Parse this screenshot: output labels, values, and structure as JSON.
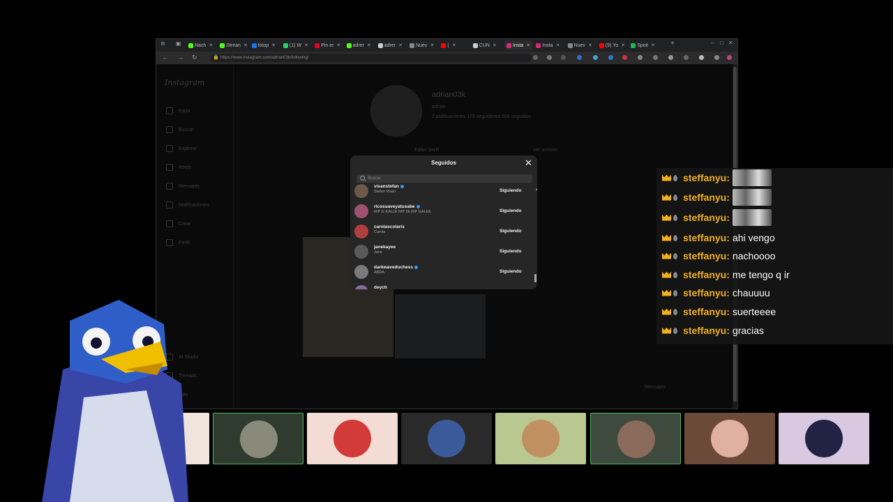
{
  "browser": {
    "tabs": [
      {
        "label": "Nach",
        "color": "#53fc18"
      },
      {
        "label": "Strean",
        "color": "#53fc18"
      },
      {
        "label": "fotop",
        "color": "#1a73e8"
      },
      {
        "label": "(1) W",
        "color": "#25d366"
      },
      {
        "label": "Pin er",
        "color": "#e60023"
      },
      {
        "label": "adrer",
        "color": "#53fc18"
      },
      {
        "label": "adrer",
        "color": "#cccccc"
      },
      {
        "label": "Nuev",
        "color": "#888888"
      },
      {
        "label": "(",
        "color": "#ff0000"
      },
      {
        "label": "CUN",
        "color": "#cccccc"
      },
      {
        "label": "Insta",
        "color": "#d62976"
      },
      {
        "label": "Insta",
        "color": "#d62976"
      },
      {
        "label": "Nuev",
        "color": "#888888"
      },
      {
        "label": "(9) Yo",
        "color": "#ff0000"
      },
      {
        "label": "Spoti",
        "color": "#1db954"
      }
    ],
    "active_tab_index": 10,
    "url": "https://www.instagram.com/adrian03k/following/",
    "new_tab": "+"
  },
  "instagram": {
    "logo": "Instagram",
    "sidebar": [
      "Inicio",
      "Buscar",
      "Explorar",
      "Reels",
      "Mensajes",
      "Notificaciones",
      "Crear",
      "Perfil",
      "AI Studio",
      "Threads",
      "Más"
    ],
    "profile": {
      "username": "adrian03k",
      "fullname": "adrian",
      "stats": "2 publicaciones   176 seguidores   288 seguidos",
      "edit_button": "Editar perfil",
      "archive_button": "Ver archivo"
    },
    "messages_button": "Mensajes"
  },
  "modal": {
    "title": "Seguidos",
    "search_placeholder": "Buscar",
    "follow_label": "Siguiendo",
    "users": [
      {
        "username": "visanstefan",
        "fullname": "Stefan Visan",
        "verified": true,
        "avatar": "#6b5a4a"
      },
      {
        "username": "ricosuaveyatusabe",
        "fullname": "RIP G KALLE RIP 5k RIP GALEE",
        "verified": true,
        "avatar": "#a05070"
      },
      {
        "username": "carolascolaris",
        "fullname": "Carola",
        "verified": false,
        "avatar": "#b04040"
      },
      {
        "username": "janekayee",
        "fullname": "Jane",
        "verified": false,
        "avatar": "#5a5a5a"
      },
      {
        "username": "darkwaveduchess",
        "fullname": "ABRA",
        "verified": true,
        "avatar": "#7a7a7a"
      },
      {
        "username": "deych",
        "fullname": "",
        "verified": false,
        "avatar": "#8a6a9a"
      }
    ]
  },
  "chat": {
    "messages": [
      {
        "user": "steffanyu:",
        "text": "",
        "emote": true
      },
      {
        "user": "steffanyu:",
        "text": "",
        "emote": true
      },
      {
        "user": "steffanyu:",
        "text": "",
        "emote": true
      },
      {
        "user": "steffanyu:",
        "text": "ahi vengo",
        "emote": false
      },
      {
        "user": "steffanyu:",
        "text": "nachoooo",
        "emote": false
      },
      {
        "user": "steffanyu:",
        "text": "me tengo q ir",
        "emote": false
      },
      {
        "user": "steffanyu:",
        "text": "chauuuu",
        "emote": false
      },
      {
        "user": "steffanyu:",
        "text": "suerteeee",
        "emote": false
      },
      {
        "user": "steffanyu:",
        "text": "gracias",
        "emote": false
      }
    ],
    "accent": "#f2b01e"
  },
  "cams": [
    {
      "bg": "#efe5dc",
      "circle": "#333333"
    },
    {
      "bg": "#2e3b2e",
      "circle": "#8a8a7a"
    },
    {
      "bg": "#f2dcd4",
      "circle": "#d33a3a"
    },
    {
      "bg": "#2a2a2a",
      "circle": "#3b5a9a"
    },
    {
      "bg": "#b8c890",
      "circle": "#c09060"
    },
    {
      "bg": "#3e4a3e",
      "circle": "#8a6a5a"
    },
    {
      "bg": "#6b4a3a",
      "circle": "#e0b0a0"
    },
    {
      "bg": "#d8c8e0",
      "circle": "#222244"
    }
  ]
}
